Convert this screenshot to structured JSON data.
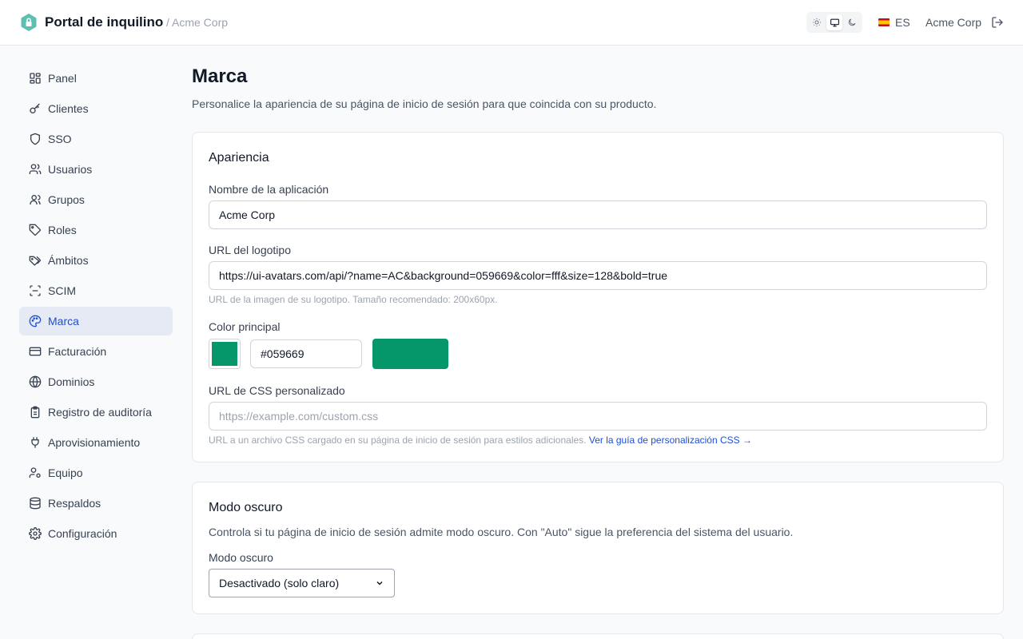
{
  "header": {
    "app_title": "Portal de inquilino",
    "org_breadcrumb": "/ Acme Corp",
    "language": "ES",
    "org_name": "Acme Corp",
    "theme_options": [
      "sun-icon",
      "monitor-icon",
      "moon-icon"
    ],
    "active_theme": "monitor-icon",
    "brand_color": "#5fbfb0"
  },
  "sidebar": {
    "items": [
      {
        "label": "Panel",
        "icon": "grid-icon"
      },
      {
        "label": "Clientes",
        "icon": "key-icon"
      },
      {
        "label": "SSO",
        "icon": "shield-icon"
      },
      {
        "label": "Usuarios",
        "icon": "users-icon"
      },
      {
        "label": "Grupos",
        "icon": "users-group-icon"
      },
      {
        "label": "Roles",
        "icon": "tag-icon"
      },
      {
        "label": "Ámbitos",
        "icon": "tags-icon"
      },
      {
        "label": "SCIM",
        "icon": "scan-icon"
      },
      {
        "label": "Marca",
        "icon": "palette-icon",
        "active": true
      },
      {
        "label": "Facturación",
        "icon": "credit-card-icon"
      },
      {
        "label": "Dominios",
        "icon": "globe-icon"
      },
      {
        "label": "Registro de auditoría",
        "icon": "clipboard-icon"
      },
      {
        "label": "Aprovisionamiento",
        "icon": "plug-icon"
      },
      {
        "label": "Equipo",
        "icon": "user-cog-icon"
      },
      {
        "label": "Respaldos",
        "icon": "database-icon"
      },
      {
        "label": "Configuración",
        "icon": "gear-icon"
      }
    ],
    "active_color": "#1d4ed8"
  },
  "page": {
    "title": "Marca",
    "subtitle": "Personalice la apariencia de su página de inicio de sesión para que coincida con su producto."
  },
  "appearance": {
    "title": "Apariencia",
    "app_name_label": "Nombre de la aplicación",
    "app_name_value": "Acme Corp",
    "logo_label": "URL del logotipo",
    "logo_value": "https://ui-avatars.com/api/?name=AC&background=059669&color=fff&size=128&bold=true",
    "logo_hint": "URL de la imagen de su logotipo. Tamaño recomendado: 200x60px.",
    "color_label": "Color principal",
    "color_value": "#059669",
    "css_label": "URL de CSS personalizado",
    "css_placeholder": "https://example.com/custom.css",
    "css_hint": "URL a un archivo CSS cargado en su página de inicio de sesión para estilos adicionales.",
    "css_guide_link": "Ver la guía de personalización CSS →"
  },
  "dark_mode": {
    "title": "Modo oscuro",
    "description": "Controla si tu página de inicio de sesión admite modo oscuro. Con \"Auto\" sigue la preferencia del sistema del usuario.",
    "select_label": "Modo oscuro",
    "selected_option": "Desactivado (solo claro)"
  }
}
